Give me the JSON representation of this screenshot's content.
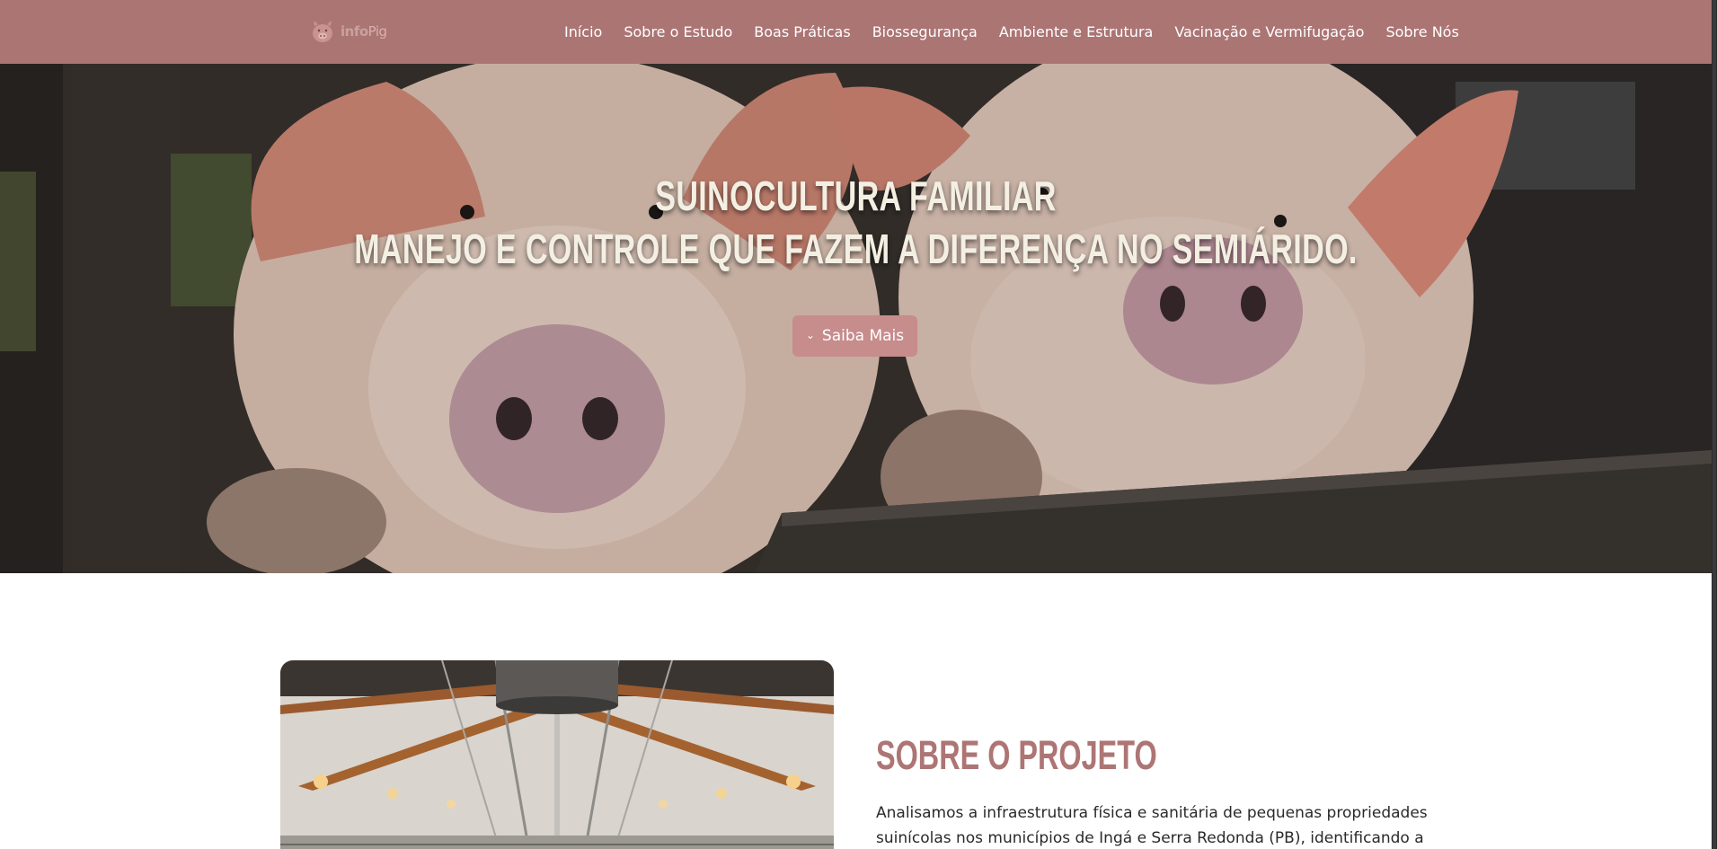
{
  "brand": {
    "logo_text_1": "info",
    "logo_text_2": "Pig",
    "logo_icon": "pig-icon"
  },
  "nav": {
    "items": [
      {
        "label": "Início"
      },
      {
        "label": "Sobre o Estudo"
      },
      {
        "label": "Boas Práticas"
      },
      {
        "label": "Biossegurança"
      },
      {
        "label": "Ambiente e Estrutura"
      },
      {
        "label": "Vacinação e Vermifugação"
      },
      {
        "label": "Sobre Nós"
      }
    ]
  },
  "hero": {
    "title_line1": "Suinocultura familiar",
    "title_line2": "Manejo e controle que fazem a diferença no semiárido.",
    "button_label": "Saiba Mais",
    "button_icon": "chevron-down-icon"
  },
  "about": {
    "title": "Sobre o Projeto",
    "text": "Analisamos a infraestrutura física e sanitária de pequenas propriedades suinícolas nos municípios de Ingá e Serra Redonda (PB), identificando a"
  },
  "colors": {
    "nav_bg": "#ab7574",
    "accent": "#ad7574",
    "button_bg": "#c78c8c",
    "hero_text": "#f4efe3"
  }
}
